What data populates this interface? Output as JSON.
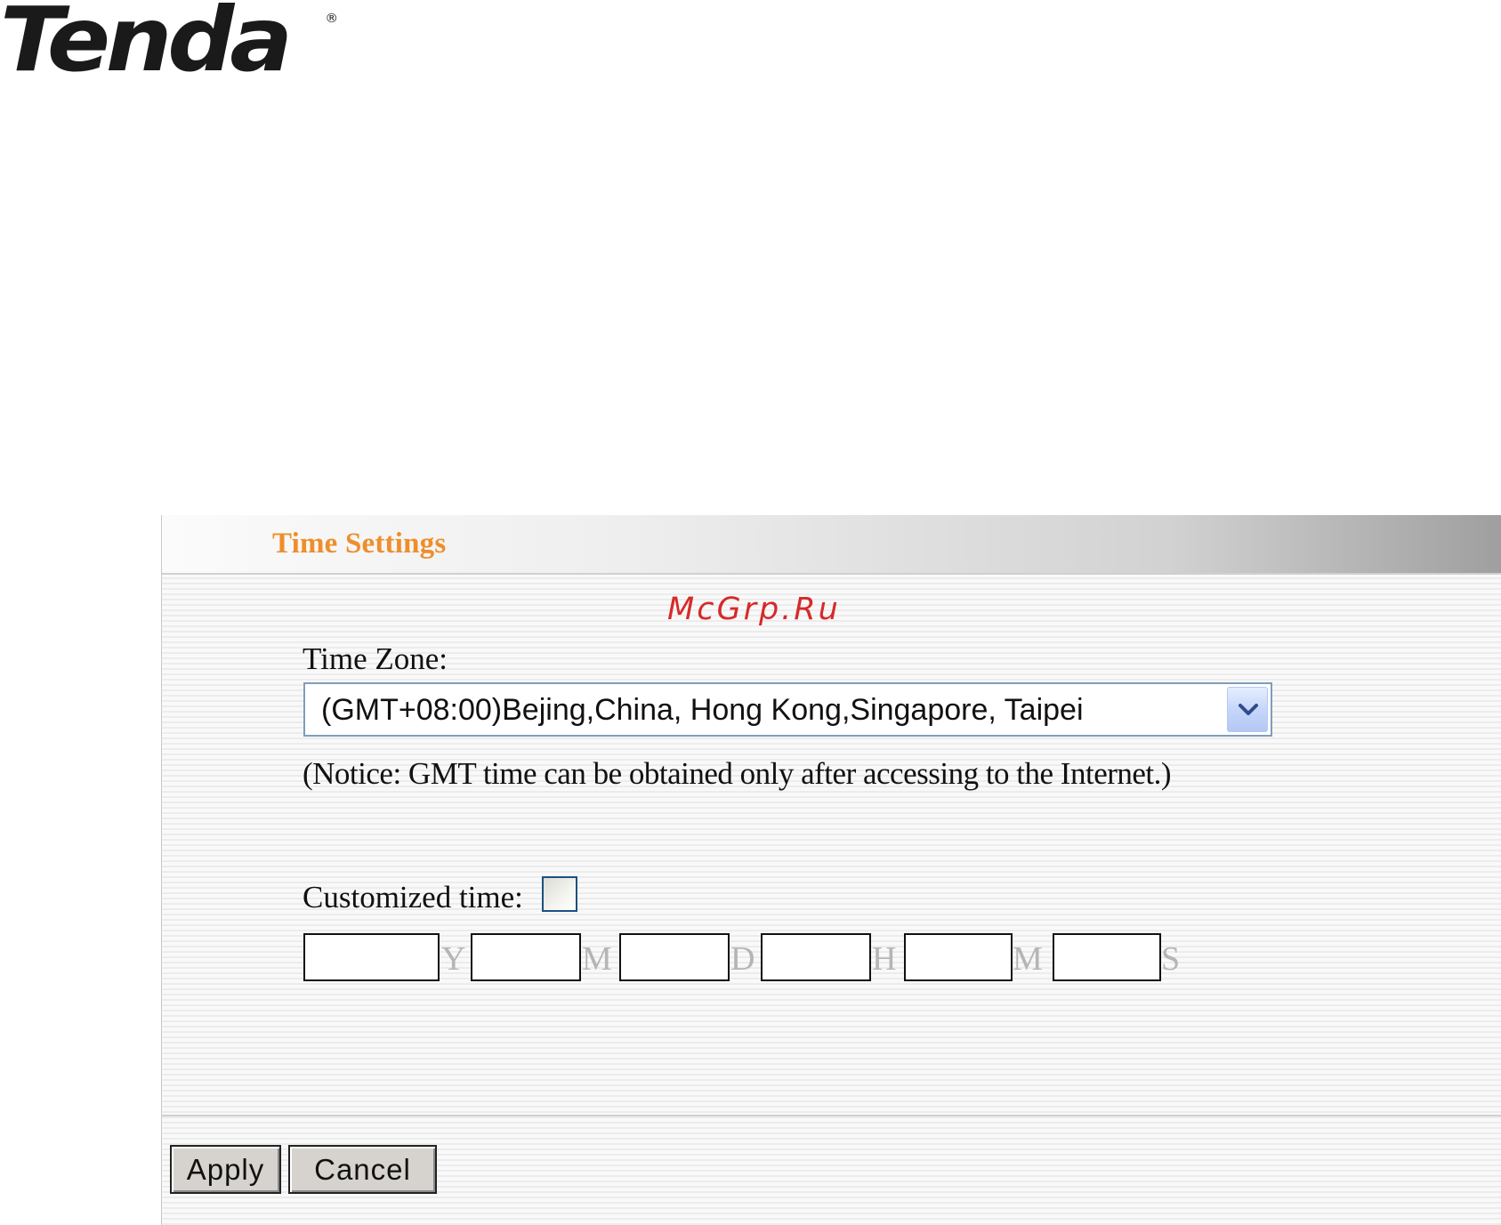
{
  "brand": {
    "logo_text": "Tenda",
    "registered_mark": "®"
  },
  "panel": {
    "title": "Time Settings",
    "watermark": "McGrp.Ru"
  },
  "time_zone": {
    "label": "Time Zone:",
    "selected": "(GMT+08:00)Bejing,China, Hong Kong,Singapore, Taipei",
    "notice": "(Notice: GMT time can be obtained only after accessing to the Internet.)"
  },
  "customized_time": {
    "label": "Customized time:",
    "checked": false,
    "fields": [
      {
        "unit": "Y",
        "value": ""
      },
      {
        "unit": "M",
        "value": ""
      },
      {
        "unit": "D",
        "value": ""
      },
      {
        "unit": "H",
        "value": ""
      },
      {
        "unit": "M",
        "value": ""
      },
      {
        "unit": "S",
        "value": ""
      }
    ]
  },
  "buttons": {
    "apply": "Apply",
    "cancel": "Cancel"
  },
  "colors": {
    "title": "#ee8e2b",
    "watermark": "#d62a2a",
    "unit_label": "#b5b5b5"
  }
}
